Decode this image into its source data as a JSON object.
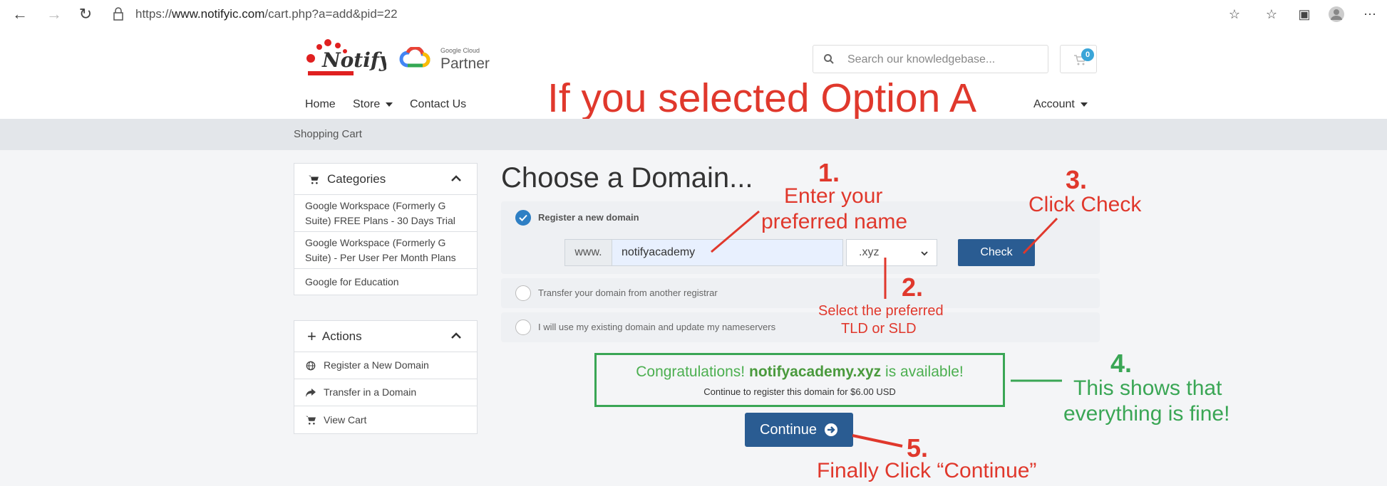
{
  "browser": {
    "url_prefix": "https://",
    "url_domain": "www.notifyic.com",
    "url_path": "/cart.php?a=add&pid=22"
  },
  "header": {
    "logo_text": "Notify",
    "partner_small": "Google Cloud",
    "partner_label": "Partner",
    "search_placeholder": "Search our knowledgebase...",
    "cart_count": "0",
    "nav": {
      "home": "Home",
      "store": "Store",
      "contact": "Contact Us",
      "account": "Account"
    }
  },
  "headline": "If you selected Option A",
  "breadcrumb": "Shopping Cart",
  "sidebar": {
    "categories_title": "Categories",
    "categories": [
      "Google Workspace (Formerly G Suite) FREE Plans - 30 Days Trial",
      "Google Workspace (Formerly G Suite) - Per User Per Month Plans",
      "Google for Education"
    ],
    "actions_title": "Actions",
    "actions": [
      "Register a New Domain",
      "Transfer in a Domain",
      "View Cart"
    ]
  },
  "domain": {
    "title": "Choose a Domain...",
    "option_register": "Register a new domain",
    "option_transfer": "Transfer your domain from another registrar",
    "option_existing": "I will use my existing domain and update my nameservers",
    "www_prefix": "www.",
    "input_value": "notifyacademy",
    "tld_value": ".xyz",
    "check_label": "Check",
    "congrats_prefix": "Congratulations!",
    "congrats_domain": "notifyacademy.xyz",
    "congrats_suffix": "is available!",
    "congrats_sub": "Continue to register this domain for $6.00 USD",
    "continue_label": "Continue"
  },
  "annotations": {
    "step1_num": "1.",
    "step1_line1": "Enter your",
    "step1_line2": "preferred name",
    "step2_num": "2.",
    "step2_line1": "Select the preferred",
    "step2_line2": "TLD or SLD",
    "step3_num": "3.",
    "step3_text": "Click Check",
    "step4_num": "4.",
    "step4_line1": "This shows that",
    "step4_line2": "everything is fine!",
    "step5_num": "5.",
    "step5_text": "Finally Click “Continue”"
  },
  "colors": {
    "annotation_red": "#e0382c",
    "annotation_green": "#3aa655",
    "primary_button": "#2a5c92",
    "radio_checked": "#2e7fc4"
  }
}
